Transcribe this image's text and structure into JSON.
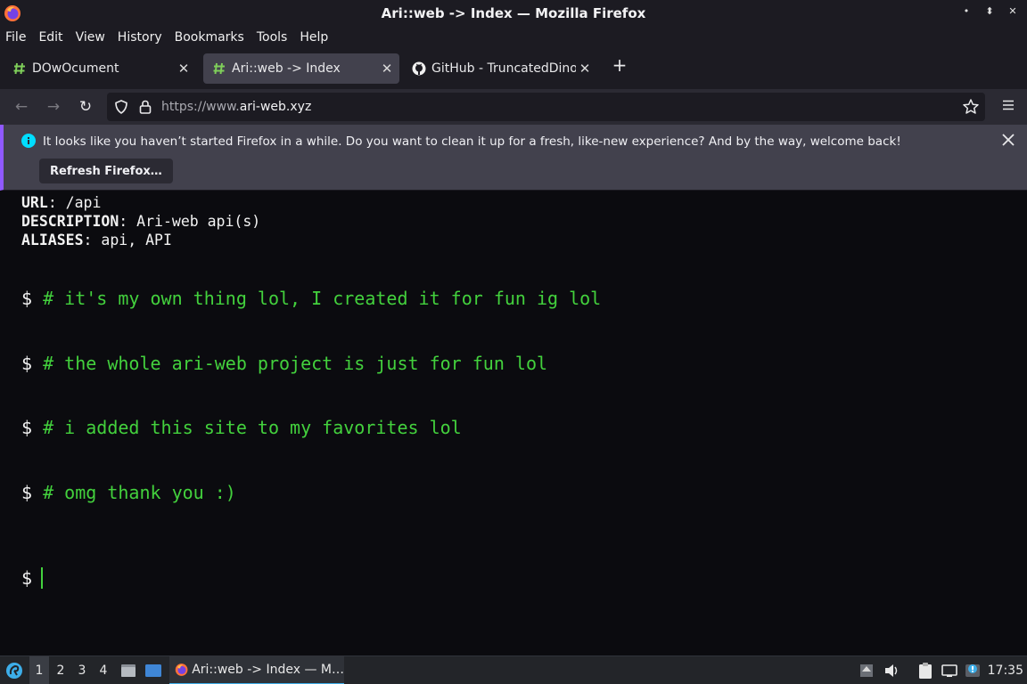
{
  "window": {
    "title": "Ari::web -> Index — Mozilla Firefox",
    "controls": [
      "minimize",
      "maximize",
      "close"
    ]
  },
  "menu": [
    "File",
    "Edit",
    "View",
    "History",
    "Bookmarks",
    "Tools",
    "Help"
  ],
  "tabs": [
    {
      "label": "DOwOcument",
      "icon": "hash-icon",
      "active": false
    },
    {
      "label": "Ari::web -> Index",
      "icon": "hash-icon",
      "active": true
    },
    {
      "label": "GitHub - TruncatedDinos",
      "icon": "github-icon",
      "active": false
    }
  ],
  "new_tab": "+",
  "urlbar": {
    "prefix": "https://www.",
    "domain": "ari-web.xyz"
  },
  "notification": {
    "message": "It looks like you haven’t started Firefox in a while. Do you want to clean it up for a fresh, like-new experience? And by the way, welcome back!",
    "button": "Refresh Firefox…"
  },
  "page": {
    "meta": [
      {
        "key": "URL",
        "value": ": /api"
      },
      {
        "key": "DESCRIPTION",
        "value": ": Ari-web api(s)"
      },
      {
        "key": "ALIASES",
        "value": ": api, API"
      }
    ],
    "prompt": "$",
    "lines": [
      "# it's my own thing lol, I created it for fun ig lol",
      "# the whole ari-web project is just for fun lol",
      "# i added this site to my favorites lol",
      "# omg thank you :)"
    ],
    "colors": {
      "comment": "#43d13d",
      "text": "#f2f2f2",
      "background": "#0b0b0f"
    }
  },
  "taskbar": {
    "workspaces": [
      "1",
      "2",
      "3",
      "4"
    ],
    "active_workspace": "1",
    "task_label": "Ari::web -> Index — M…",
    "clock": "17:35"
  }
}
